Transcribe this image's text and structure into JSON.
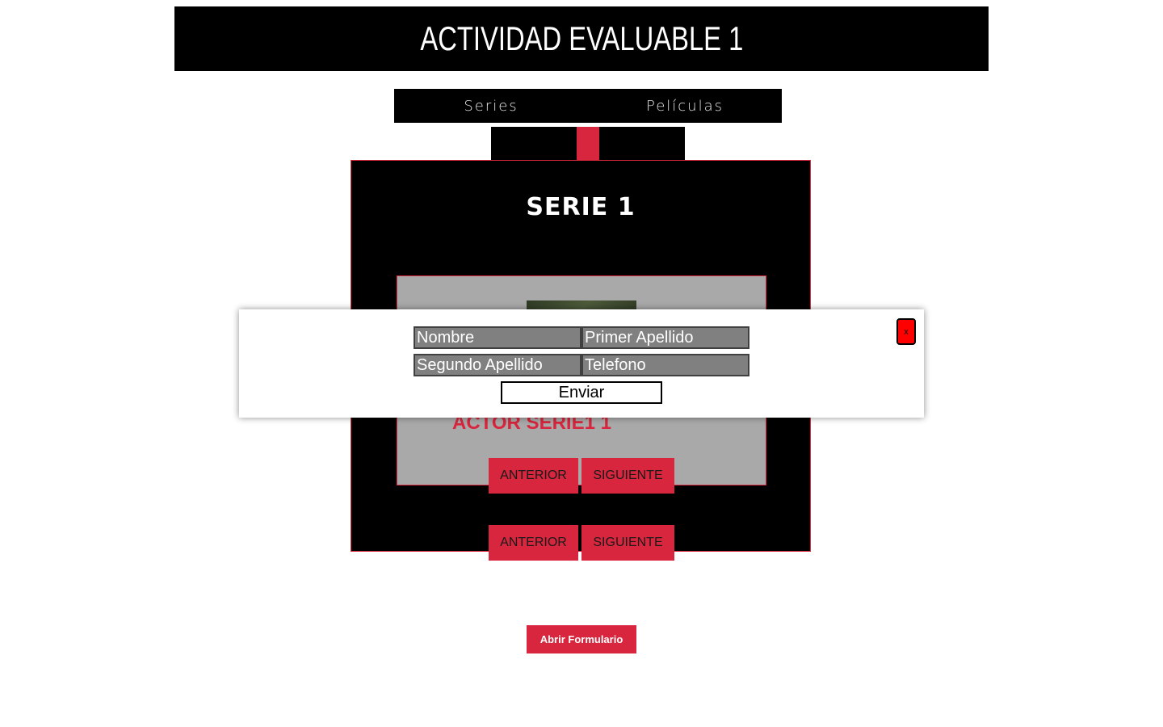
{
  "header": {
    "title": "ACTIVIDAD EVALUABLE 1"
  },
  "nav": {
    "items": [
      {
        "label": "Series"
      },
      {
        "label": "Películas"
      }
    ]
  },
  "serie": {
    "title": "SERIE 1",
    "actor": {
      "name": "ACTOR SERIE1 1"
    },
    "inner_nav": {
      "prev_label": "ANTERIOR",
      "next_label": "SIGUIENTE"
    },
    "outer_nav": {
      "prev_label": "ANTERIOR",
      "next_label": "SIGUIENTE"
    }
  },
  "modal": {
    "fields": {
      "nombre_placeholder": "Nombre",
      "primer_apellido_placeholder": "Primer Apellido",
      "segundo_apellido_placeholder": "Segundo Apellido",
      "telefono_placeholder": "Telefono"
    },
    "submit_label": "Enviar",
    "close_label": "x"
  },
  "open_form_label": "Abrir Formulario",
  "colors": {
    "accent": "#d7263d",
    "panel": "#000000",
    "card": "#a9a9a9",
    "field": "#808080",
    "close": "#ff0000"
  }
}
